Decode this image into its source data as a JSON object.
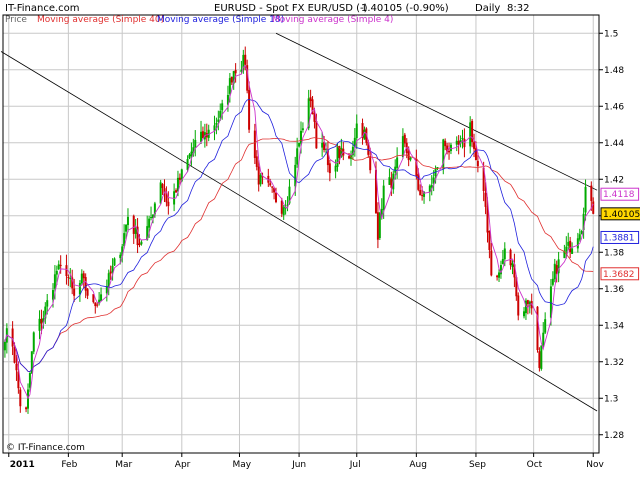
{
  "header": {
    "brand": "IT-Finance.com",
    "title": "EURUSD - Spot FX EUR/USD (-)",
    "quote": "1.40105 (-0.90%)",
    "period": "Daily",
    "time": "8:32"
  },
  "legend": {
    "price": "Price",
    "ma40": "Moving average (Simple 40)",
    "ma18": "Moving average (Simple 18)",
    "ma4": "Moving average (Simple 4)"
  },
  "watermark": "© IT-Finance.com",
  "colors": {
    "up": "#00aa00",
    "down": "#cc0000",
    "ma40": "#e03030",
    "ma18": "#2020dd",
    "ma4": "#cc33cc",
    "grid": "#c8c8c8",
    "trend": "#000000",
    "last_box": "#ffd700"
  },
  "chart_data": {
    "type": "candlestick",
    "ylim": [
      1.27,
      1.51
    ],
    "yticks": [
      "1.28",
      "1.3",
      "1.32",
      "1.34",
      "1.36",
      "1.38",
      "1.4",
      "1.42",
      "1.44",
      "1.46",
      "1.48",
      "1.5"
    ],
    "xticks": [
      "2011",
      "Feb",
      "Mar",
      "Apr",
      "May",
      "Jun",
      "Jul",
      "Aug",
      "Sep",
      "Oct",
      "Nov"
    ],
    "grid": true,
    "price_boxes": [
      {
        "label": "1.4118",
        "series": "ma4"
      },
      {
        "label": "1.40105",
        "series": "last"
      },
      {
        "label": "1.3881",
        "series": "ma18"
      },
      {
        "label": "1.3682",
        "series": "ma40"
      }
    ],
    "trendlines": [
      {
        "from": [
          "2010-12-28",
          1.49
        ],
        "to": [
          "2011-11-03",
          1.293
        ]
      },
      {
        "from": [
          "2011-05-20",
          1.5
        ],
        "to": [
          "2011-11-03",
          1.414
        ]
      }
    ],
    "anchors": [
      [
        "2010-12-31",
        1.335
      ],
      [
        "2011-01-03",
        1.33
      ],
      [
        "2011-01-07",
        1.297
      ],
      [
        "2011-01-10",
        1.292
      ],
      [
        "2011-01-14",
        1.335
      ],
      [
        "2011-01-19",
        1.345
      ],
      [
        "2011-01-26",
        1.37
      ],
      [
        "2011-01-31",
        1.37
      ],
      [
        "2011-02-04",
        1.355
      ],
      [
        "2011-02-08",
        1.365
      ],
      [
        "2011-02-14",
        1.35
      ],
      [
        "2011-02-22",
        1.365
      ],
      [
        "2011-03-01",
        1.385
      ],
      [
        "2011-03-04",
        1.4
      ],
      [
        "2011-03-10",
        1.385
      ],
      [
        "2011-03-15",
        1.395
      ],
      [
        "2011-03-21",
        1.42
      ],
      [
        "2011-03-25",
        1.405
      ],
      [
        "2011-03-31",
        1.42
      ],
      [
        "2011-04-08",
        1.44
      ],
      [
        "2011-04-14",
        1.445
      ],
      [
        "2011-04-21",
        1.455
      ],
      [
        "2011-04-28",
        1.48
      ],
      [
        "2011-05-04",
        1.485
      ],
      [
        "2011-05-06",
        1.45
      ],
      [
        "2011-05-11",
        1.42
      ],
      [
        "2011-05-16",
        1.415
      ],
      [
        "2011-05-23",
        1.405
      ],
      [
        "2011-05-26",
        1.41
      ],
      [
        "2011-06-03",
        1.45
      ],
      [
        "2011-06-07",
        1.465
      ],
      [
        "2011-06-10",
        1.44
      ],
      [
        "2011-06-14",
        1.44
      ],
      [
        "2011-06-17",
        1.42
      ],
      [
        "2011-06-21",
        1.435
      ],
      [
        "2011-06-27",
        1.43
      ],
      [
        "2011-07-01",
        1.45
      ],
      [
        "2011-07-05",
        1.445
      ],
      [
        "2011-07-11",
        1.405
      ],
      [
        "2011-07-12",
        1.39
      ],
      [
        "2011-07-15",
        1.415
      ],
      [
        "2011-07-20",
        1.42
      ],
      [
        "2011-07-25",
        1.44
      ],
      [
        "2011-07-29",
        1.43
      ],
      [
        "2011-08-02",
        1.415
      ],
      [
        "2011-08-05",
        1.41
      ],
      [
        "2011-08-10",
        1.42
      ],
      [
        "2011-08-15",
        1.44
      ],
      [
        "2011-08-19",
        1.435
      ],
      [
        "2011-08-26",
        1.44
      ],
      [
        "2011-08-29",
        1.45
      ],
      [
        "2011-09-01",
        1.43
      ],
      [
        "2011-09-06",
        1.405
      ],
      [
        "2011-09-09",
        1.37
      ],
      [
        "2011-09-12",
        1.365
      ],
      [
        "2011-09-16",
        1.38
      ],
      [
        "2011-09-21",
        1.37
      ],
      [
        "2011-09-23",
        1.345
      ],
      [
        "2011-09-29",
        1.355
      ],
      [
        "2011-10-04",
        1.32
      ],
      [
        "2011-10-07",
        1.34
      ],
      [
        "2011-10-12",
        1.37
      ],
      [
        "2011-10-17",
        1.38
      ],
      [
        "2011-10-21",
        1.385
      ],
      [
        "2011-10-26",
        1.395
      ],
      [
        "2011-10-28",
        1.415
      ],
      [
        "2011-11-01",
        1.40105
      ]
    ]
  }
}
